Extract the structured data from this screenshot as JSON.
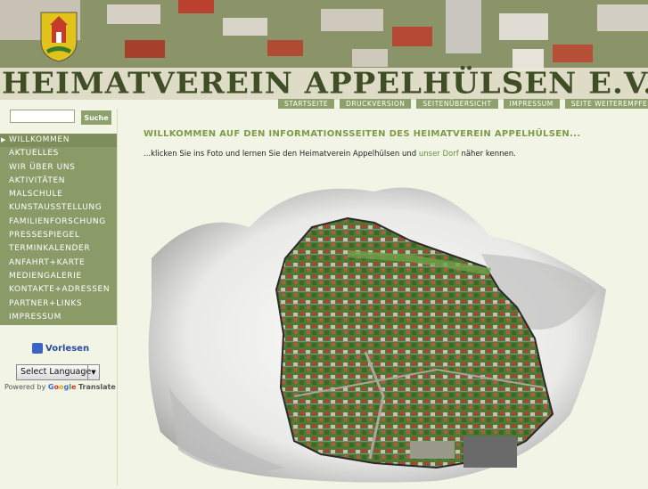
{
  "header": {
    "title": "HEIMATVEREIN APPELHÜLSEN E.V."
  },
  "topnav": [
    "STARTSEITE",
    "DRUCKVERSION",
    "SEITENÜBERSICHT",
    "IMPRESSUM",
    "SEITE WEITEREMPFEHLEN"
  ],
  "search": {
    "placeholder": "",
    "button": "Suche"
  },
  "sidebar": {
    "items": [
      "WILLKOMMEN",
      "AKTUELLES",
      "WIR ÜBER UNS",
      "AKTIVITÄTEN",
      "MALSCHULE",
      "KUNSTAUSSTELLUNG",
      "FAMILIENFORSCHUNG",
      "PRESSESPIEGEL",
      "TERMINKALENDER",
      "ANFAHRT+KARTE",
      "MEDIENGALERIE",
      "KONTAKTE+ADRESSEN",
      "PARTNER+LINKS",
      "IMPRESSUM"
    ],
    "active_index": 0,
    "vorlesen": "Vorlesen",
    "language": "Select Language",
    "powered_by": "Powered by",
    "google": [
      "G",
      "o",
      "o",
      "g",
      "l",
      "e"
    ],
    "translate": "Translate"
  },
  "main": {
    "title": "WILLKOMMEN AUF DEN INFORMATIONSSEITEN DES HEIMATVEREIN APPELHÜLSEN...",
    "intro_before": "...klicken Sie ins Foto und lernen Sie den Heimatverein Appelhülsen und ",
    "intro_link": "unser Dorf",
    "intro_after": " näher kennen."
  },
  "colors": {
    "accent": "#8ea06b",
    "title": "#7e9a4a",
    "background": "#f2f5e6",
    "header_text": "#3f4e25"
  }
}
